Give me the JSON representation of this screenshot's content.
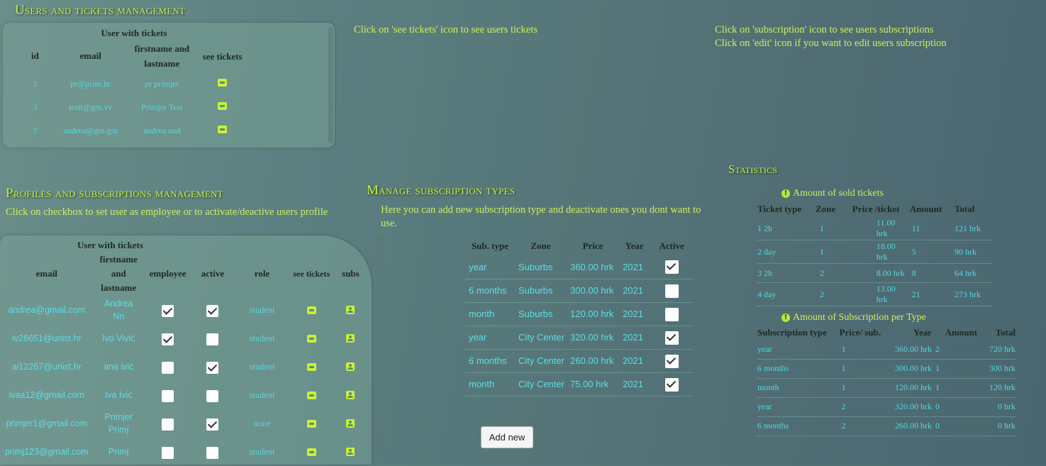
{
  "users_tickets": {
    "title": "Users and tickets management",
    "table_caption": "User with tickets",
    "headers": [
      "id",
      "email",
      "firstname and lastname",
      "see tickets"
    ],
    "rows": [
      {
        "id": "1",
        "email": "pr@prim.hr",
        "name": "pr primjer"
      },
      {
        "id": "3",
        "email": "testt@gm.vv",
        "name": "Primjer Test"
      },
      {
        "id": "7",
        "email": "andrea@gm.gm",
        "name": "andrea and"
      }
    ]
  },
  "notes": {
    "see_tickets": "Click on 'see tickets' icon to see users tickets",
    "subscription_1": "Click on 'subscription' icon to see users subscriptions",
    "subscription_2": "Click on 'edit' icon if you want to edit users subscription"
  },
  "profiles": {
    "title": "Profiles and subscriptions management",
    "note": "Click on checkbox to set user as employee or to activate/deactive users profile",
    "table_caption": "User with tickets",
    "headers": [
      "email",
      "firstname and lastname",
      "employee",
      "active",
      "role",
      "see tickets",
      "subs"
    ],
    "rows": [
      {
        "email": "andrea@gmail.com",
        "name1": "Andrea",
        "name2": "Nn",
        "employee": true,
        "active": true,
        "role": "student"
      },
      {
        "email": "iv26651@unist.hr",
        "name1": "Ivo Vivić",
        "name2": "",
        "employee": true,
        "active": false,
        "role": "student"
      },
      {
        "email": "ai12267@unist.hr",
        "name1": "ana ivić",
        "name2": "",
        "employee": false,
        "active": true,
        "role": "student"
      },
      {
        "email": "ivaa12@gmail.com",
        "name1": "Iva Ivić",
        "name2": "",
        "employee": false,
        "active": false,
        "role": "student"
      },
      {
        "email": "primjer1@gmail.com",
        "name1": "Primjer",
        "name2": "Primj",
        "employee": false,
        "active": true,
        "role": "none"
      },
      {
        "email": "primj123@gmail.com",
        "name1": "Primj",
        "name2": "",
        "employee": false,
        "active": false,
        "role": "student"
      }
    ]
  },
  "manage_subs": {
    "title": "Manage subscription types",
    "note": "Here you can add new subscription type and deactivate ones you dont want to use.",
    "headers": [
      "Sub. type",
      "Zone",
      "Price",
      "Year",
      "Active"
    ],
    "rows": [
      {
        "type": "year",
        "zone": "Suburbs",
        "price": "360.00 hrk",
        "year": "2021",
        "active": true
      },
      {
        "type": "6 months",
        "zone": "Suburbs",
        "price": "300.00 hrk",
        "year": "2021",
        "active": false
      },
      {
        "type": "month",
        "zone": "Suburbs",
        "price": "120.00 hrk",
        "year": "2021",
        "active": false
      },
      {
        "type": "year",
        "zone": "City Center",
        "price": "320.00 hrk",
        "year": "2021",
        "active": true
      },
      {
        "type": "6 months",
        "zone": "City Center",
        "price": "260.00 hrk",
        "year": "2021",
        "active": true
      },
      {
        "type": "month",
        "zone": "City Center",
        "price": "75.00 hrk",
        "year": "2021",
        "active": true
      }
    ],
    "add_button": "Add new"
  },
  "statistics": {
    "title": "Statistics",
    "sold_title": "Amount of sold tickets",
    "sold_headers": [
      "Ticket type",
      "Zone",
      "Price /ticket",
      "Amount",
      "Total"
    ],
    "sold_rows": [
      [
        "1 2h",
        "1",
        "11.00 hrk",
        "11",
        "121 hrk"
      ],
      [
        "2 day",
        "1",
        "18.00 hrk",
        "5",
        "90 hrk"
      ],
      [
        "3 2h",
        "2",
        "8.00 hrk",
        "8",
        "64 hrk"
      ],
      [
        "4 day",
        "2",
        "13.00 hrk",
        "21",
        "273 hrk"
      ]
    ],
    "subs_title": "Amount of Subscription per Type",
    "subs_headers": [
      "Subscription type",
      "Price/ sub.",
      "Year",
      "Amount",
      "Total"
    ],
    "subs_rows": [
      [
        "year",
        "1",
        "360.00 hrk",
        "2",
        "720 hrk"
      ],
      [
        "6 months",
        "1",
        "300.00 hrk",
        "1",
        "300 hrk"
      ],
      [
        "month",
        "1",
        "120.00 hrk",
        "1",
        "120 hrk"
      ],
      [
        "year",
        "2",
        "320.00 hrk",
        "0",
        "0 hrk"
      ],
      [
        "6 months",
        "2",
        "260.00 hrk",
        "0",
        "0 hrk"
      ]
    ]
  }
}
